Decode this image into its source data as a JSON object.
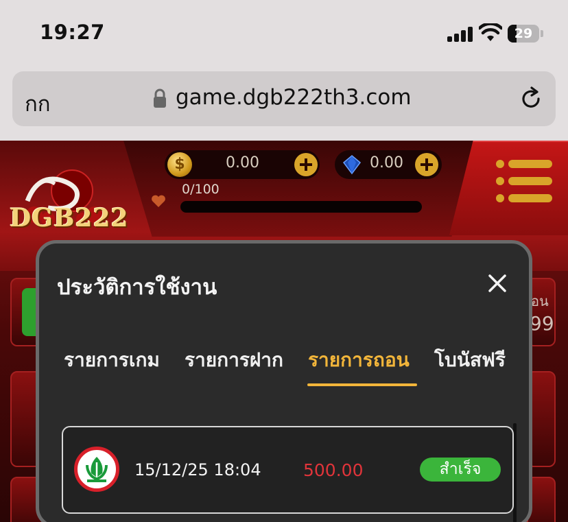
{
  "status_bar": {
    "time": "19:27",
    "battery_level": "29"
  },
  "browser": {
    "text_size_label": "กก",
    "url": "game.dgb222th3.com"
  },
  "game_header": {
    "logo_text": "DGB222",
    "coin_balance": "0.00",
    "gem_balance": "0.00",
    "level_progress": "0/100",
    "level_progress_fraction": 0
  },
  "background_partial": {
    "right_card_text_1": "อน",
    "right_card_text_2": "99"
  },
  "modal": {
    "title": "ประวัติการใช้งาน",
    "tabs": [
      {
        "label": "รายการเกม",
        "active": false
      },
      {
        "label": "รายการฝาก",
        "active": false
      },
      {
        "label": "รายการถอน",
        "active": true
      },
      {
        "label": "โบนัสฟรี",
        "active": false
      }
    ],
    "transactions": [
      {
        "date": "15/12/25 18:04",
        "amount": "500.00",
        "status": "สำเร็จ"
      }
    ]
  },
  "colors": {
    "accent_gold": "#f2b53a",
    "amount_red": "#e0343a",
    "success_green": "#3bb53b",
    "bank_red": "#d8202a",
    "bank_green": "#1a9a3a"
  }
}
